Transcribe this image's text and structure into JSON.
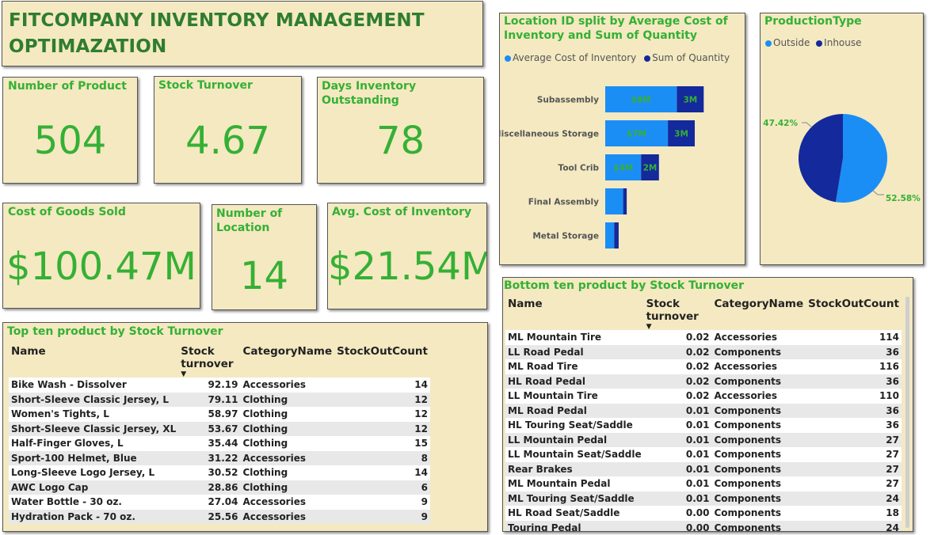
{
  "header": {
    "title": "FITCOMPANY INVENTORY MANAGEMENT OPTIMAZATION"
  },
  "kpis": {
    "products": {
      "label": "Number of Product",
      "value": "504"
    },
    "turnover": {
      "label": "Stock Turnover",
      "value": "4.67"
    },
    "dio": {
      "label": "Days Inventory Outstanding",
      "value": "78"
    },
    "cogs": {
      "label": "Cost of Goods Sold",
      "value": "$100.47M"
    },
    "locations": {
      "label": "Number of Location",
      "value": "14"
    },
    "avg_cost": {
      "label": "Avg. Cost of Inventory",
      "value": "$21.54M"
    }
  },
  "colors": {
    "accent": "#35b035",
    "title_dark": "#2f7d2f",
    "card_bg": "#f4e9c1",
    "series_light": "#1b8ef5",
    "series_dark": "#14299b"
  },
  "location_chart": {
    "title": "Location ID split by Average Cost of Inventory and Sum of Quantity",
    "legend": [
      "Average Cost of Inventory",
      "Sum of Quantity"
    ]
  },
  "production_chart": {
    "title": "ProductionType",
    "legend": [
      "Outside",
      "Inhouse"
    ],
    "label_inhouse": "47.42%",
    "label_outside": "52.58%"
  },
  "chart_data": [
    {
      "type": "bar",
      "title": "Location ID split by Average Cost of Inventory and Sum of Quantity",
      "orientation": "horizontal",
      "stacked": true,
      "categories": [
        "Subassembly",
        "Miscellaneous Storage",
        "Tool Crib",
        "Final Assembly",
        "Metal Storage"
      ],
      "series": [
        {
          "name": "Average Cost of Inventory",
          "values": [
            8,
            7,
            4,
            2,
            1
          ],
          "labels": [
            "$8M",
            "$7M",
            "$4M",
            "",
            ""
          ],
          "color": "#1b8ef5"
        },
        {
          "name": "Sum of Quantity",
          "values": [
            3,
            3,
            2,
            0.4,
            0.5
          ],
          "labels": [
            "3M",
            "3M",
            "2M",
            "",
            ""
          ],
          "color": "#14299b"
        }
      ],
      "legend_position": "top-left",
      "grid": false
    },
    {
      "type": "pie",
      "title": "ProductionType",
      "categories": [
        "Outside",
        "Inhouse"
      ],
      "values": [
        52.58,
        47.42
      ],
      "labels": [
        "52.58%",
        "47.42%"
      ],
      "colors": [
        "#1b8ef5",
        "#14299b"
      ],
      "legend_position": "top-left"
    }
  ],
  "top_table": {
    "title": "Top ten product by Stock Turnover",
    "columns": [
      "Name",
      "Stock turnover",
      "CategoryName",
      "StockOutCount"
    ],
    "sort_indicator": "▼",
    "rows": [
      [
        "Bike Wash - Dissolver",
        "92.19",
        "Accessories",
        "14"
      ],
      [
        "Short-Sleeve Classic Jersey, L",
        "79.11",
        "Clothing",
        "12"
      ],
      [
        "Women's Tights, L",
        "58.97",
        "Clothing",
        "12"
      ],
      [
        "Short-Sleeve Classic Jersey, XL",
        "53.67",
        "Clothing",
        "12"
      ],
      [
        "Half-Finger Gloves, L",
        "35.44",
        "Clothing",
        "15"
      ],
      [
        "Sport-100 Helmet, Blue",
        "31.22",
        "Accessories",
        "8"
      ],
      [
        "Long-Sleeve Logo Jersey, L",
        "30.52",
        "Clothing",
        "14"
      ],
      [
        "AWC Logo Cap",
        "28.86",
        "Clothing",
        "6"
      ],
      [
        "Water Bottle - 30 oz.",
        "27.04",
        "Accessories",
        "9"
      ],
      [
        "Hydration Pack - 70 oz.",
        "25.56",
        "Accessories",
        "9"
      ]
    ]
  },
  "bottom_table": {
    "title": "Bottom ten product by Stock Turnover",
    "columns": [
      "Name",
      "Stock turnover",
      "CategoryName",
      "StockOutCount"
    ],
    "sort_indicator": "▼",
    "rows": [
      [
        "ML Mountain Tire",
        "0.02",
        "Accessories",
        "114"
      ],
      [
        "LL Road Pedal",
        "0.02",
        "Components",
        "36"
      ],
      [
        "ML Road Tire",
        "0.02",
        "Accessories",
        "116"
      ],
      [
        "HL Road Pedal",
        "0.02",
        "Components",
        "36"
      ],
      [
        "LL Mountain Tire",
        "0.02",
        "Accessories",
        "110"
      ],
      [
        "ML Road Pedal",
        "0.01",
        "Components",
        "36"
      ],
      [
        "HL Touring Seat/Saddle",
        "0.01",
        "Components",
        "36"
      ],
      [
        "LL Mountain Pedal",
        "0.01",
        "Components",
        "27"
      ],
      [
        "LL Mountain Seat/Saddle",
        "0.01",
        "Components",
        "27"
      ],
      [
        "Rear Brakes",
        "0.01",
        "Components",
        "27"
      ],
      [
        "ML Mountain Pedal",
        "0.01",
        "Components",
        "27"
      ],
      [
        "ML Touring Seat/Saddle",
        "0.01",
        "Components",
        "24"
      ],
      [
        "HL Road Seat/Saddle",
        "0.00",
        "Components",
        "18"
      ],
      [
        "Touring Pedal",
        "0.00",
        "Components",
        "24"
      ]
    ]
  }
}
